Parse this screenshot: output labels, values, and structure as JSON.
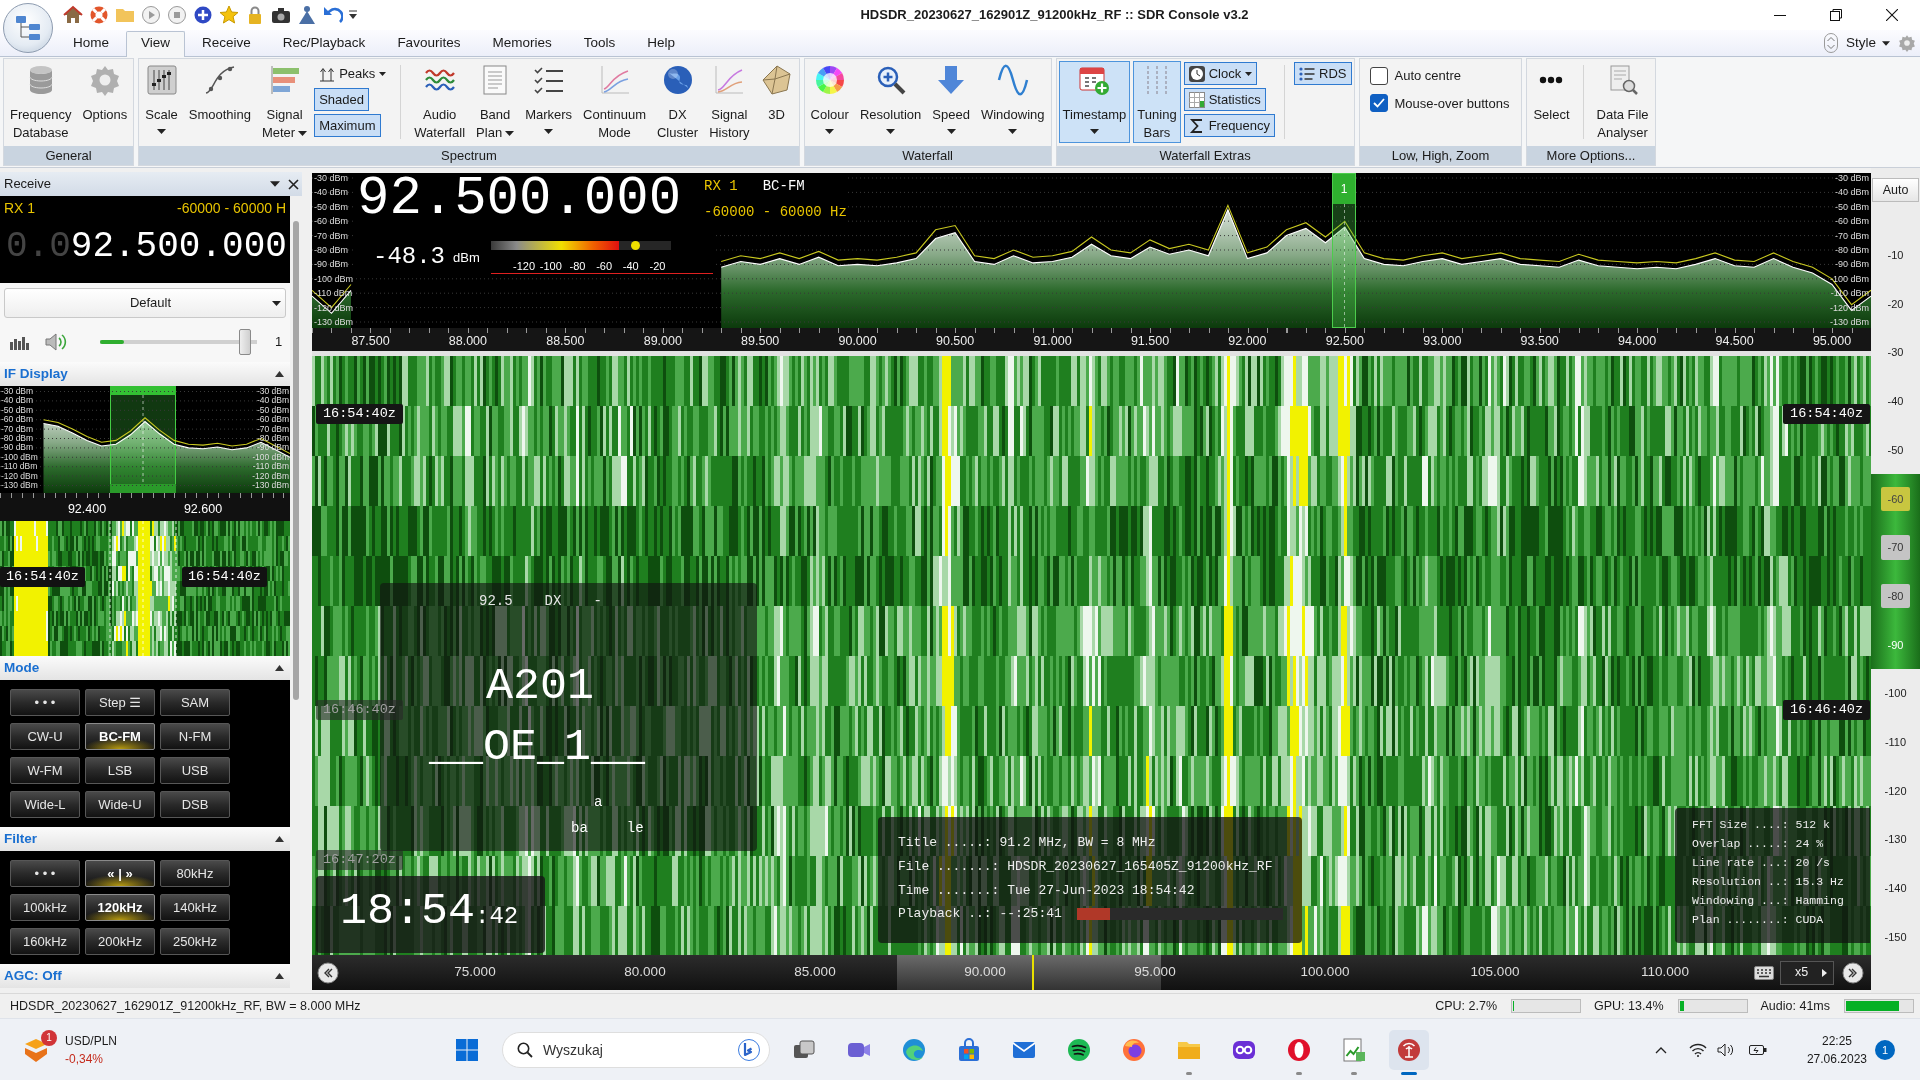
{
  "window": {
    "title": "HDSDR_20230627_162901Z_91200kHz_RF :: SDR Console v3.2"
  },
  "ribbon": {
    "tabs": [
      {
        "label": "Home",
        "selected": false
      },
      {
        "label": "View",
        "selected": true
      },
      {
        "label": "Receive",
        "selected": false
      },
      {
        "label": "Rec/Playback",
        "selected": false
      },
      {
        "label": "Favourites",
        "selected": false
      },
      {
        "label": "Memories",
        "selected": false
      },
      {
        "label": "Tools",
        "selected": false
      },
      {
        "label": "Help",
        "selected": false
      }
    ],
    "style_menu": "Style",
    "groups": [
      {
        "label": "General",
        "items": [
          {
            "kind": "large",
            "label": "Frequency\nDatabase",
            "dropdown": false,
            "on": false
          },
          {
            "kind": "large",
            "label": "Options",
            "dropdown": false,
            "on": false
          }
        ]
      },
      {
        "label": "Spectrum",
        "items": [
          {
            "kind": "large",
            "label": "Scale",
            "dropdown": true,
            "on": false
          },
          {
            "kind": "large",
            "label": "Smoothing",
            "dropdown": false,
            "on": false
          },
          {
            "kind": "large",
            "label": "Signal\nMeter",
            "dropdown": true,
            "on": false
          },
          {
            "kind": "small",
            "label": "Peaks",
            "dropdown": true,
            "on": false
          },
          {
            "kind": "small",
            "label": "Shaded",
            "dropdown": false,
            "on": true
          },
          {
            "kind": "small",
            "label": "Maximum",
            "dropdown": false,
            "on": true
          },
          {
            "kind": "separator"
          },
          {
            "kind": "large",
            "label": "Audio\nWaterfall",
            "dropdown": false,
            "on": false
          },
          {
            "kind": "large",
            "label": "Band\nPlan",
            "dropdown": true,
            "on": false
          },
          {
            "kind": "large",
            "label": "Markers",
            "dropdown": true,
            "on": false
          },
          {
            "kind": "large",
            "label": "Continuum\nMode",
            "dropdown": false,
            "on": false
          },
          {
            "kind": "large",
            "label": "DX\nCluster",
            "dropdown": false,
            "on": false
          },
          {
            "kind": "large",
            "label": "Signal\nHistory",
            "dropdown": false,
            "on": false
          },
          {
            "kind": "large",
            "label": "3D",
            "dropdown": false,
            "on": false
          }
        ]
      },
      {
        "label": "Waterfall",
        "items": [
          {
            "kind": "large",
            "label": "Colour",
            "dropdown": true,
            "on": false
          },
          {
            "kind": "large",
            "label": "Resolution",
            "dropdown": true,
            "on": false
          },
          {
            "kind": "large",
            "label": "Speed",
            "dropdown": true,
            "on": false
          },
          {
            "kind": "large",
            "label": "Windowing",
            "dropdown": true,
            "on": false
          }
        ]
      },
      {
        "label": "Waterfall Extras",
        "items": [
          {
            "kind": "large",
            "label": "Timestamp",
            "dropdown": true,
            "on": true
          },
          {
            "kind": "large",
            "label": "Tuning\nBars",
            "dropdown": false,
            "on": true
          },
          {
            "kind": "small",
            "label": "Clock",
            "dropdown": true,
            "on": true
          },
          {
            "kind": "small",
            "label": "Statistics",
            "dropdown": false,
            "on": true
          },
          {
            "kind": "small",
            "label": "Frequency",
            "dropdown": false,
            "on": true
          },
          {
            "kind": "separator"
          },
          {
            "kind": "small",
            "label": "RDS",
            "dropdown": false,
            "on": true
          }
        ]
      },
      {
        "label": "Low, High, Zoom",
        "items": [
          {
            "kind": "check",
            "label": "Auto centre",
            "checked": false
          },
          {
            "kind": "check",
            "label": "Mouse-over buttons",
            "checked": true
          }
        ]
      },
      {
        "label": "More Options...",
        "items": [
          {
            "kind": "large",
            "label": "Select",
            "dropdown": false,
            "on": false
          },
          {
            "kind": "separator"
          },
          {
            "kind": "large",
            "label": "Data File\nAnalyser",
            "dropdown": false,
            "on": false
          }
        ]
      }
    ]
  },
  "receive_panel": {
    "title": "Receive",
    "receiver": "RX 1",
    "span": "-60000 - 60000 H",
    "frequency_prefix": "0.0",
    "frequency": "92.500.000",
    "profile": "Default",
    "audio": {
      "level": 0.15
    },
    "volume": {
      "level": 0.96
    },
    "volume_value": "1",
    "if_display": {
      "title": "IF Display",
      "chart_data": {
        "type": "line",
        "x": [
          92.325,
          92.35,
          92.375,
          92.4,
          92.425,
          92.45,
          92.475,
          92.5,
          92.525,
          92.55,
          92.575,
          92.6,
          92.625,
          92.65,
          92.675,
          92.7,
          92.725,
          92.75
        ],
        "series": [
          {
            "color": "#ffffff",
            "values": [
              -64,
              -67,
              -74,
              -82,
              -88,
              -86,
              -76,
              -62,
              -75,
              -86,
              -90,
              -91,
              -89,
              -92,
              -90,
              -84,
              -92,
              -100
            ]
          },
          {
            "color": "#c8c820",
            "values": [
              -60,
              -63,
              -70,
              -78,
              -84,
              -82,
              -72,
              -58,
              -71,
              -82,
              -86,
              -87,
              -85,
              -88,
              -86,
              -80,
              -88,
              -96
            ]
          }
        ],
        "grid": true,
        "xlim": [
          92.25,
          92.75
        ],
        "ylim": [
          -138,
          -24.1
        ],
        "xticks": [
          {
            "value": 92.4,
            "label": "92.400"
          },
          {
            "value": 92.6,
            "label": "92.600"
          }
        ],
        "yticks": [
          {
            "value": -30,
            "label": "-30 dBm"
          },
          {
            "value": -40,
            "label": "-40 dBm"
          },
          {
            "value": -50,
            "label": "-50 dBm"
          },
          {
            "value": -60,
            "label": "-60 dBm"
          },
          {
            "value": -70,
            "label": "-70 dBm"
          },
          {
            "value": -80,
            "label": "-80 dBm"
          },
          {
            "value": -90,
            "label": "-90 dBm"
          },
          {
            "value": -100,
            "label": "-100 dBm"
          },
          {
            "value": -110,
            "label": "-110 dBm"
          },
          {
            "value": -120,
            "label": "-120 dBm"
          },
          {
            "value": -130,
            "label": "-130 dBm"
          }
        ]
      },
      "db_right": [
        "-30 dBm",
        "-40 dBm",
        "-50 dBm",
        "-60 dBm",
        "-70 dBm",
        "-80 dBm",
        "-90 dBm",
        "-100 dBm",
        "-110 dBm",
        "-120 dBm",
        "-130 dBm"
      ],
      "timestamps": [
        "16:54:40z",
        "16:54:40z"
      ]
    },
    "mode": {
      "title": "Mode",
      "buttons": [
        {
          "label": "• • •",
          "selected": false
        },
        {
          "label": "Step ☰",
          "selected": false
        },
        {
          "label": "SAM",
          "selected": false
        },
        {
          "label": "CW-U",
          "selected": false
        },
        {
          "label": "BC-FM",
          "selected": true
        },
        {
          "label": "N-FM",
          "selected": false
        },
        {
          "label": "W-FM",
          "selected": false
        },
        {
          "label": "LSB",
          "selected": false
        },
        {
          "label": "USB",
          "selected": false
        },
        {
          "label": "Wide-L",
          "selected": false
        },
        {
          "label": "Wide-U",
          "selected": false
        },
        {
          "label": "DSB",
          "selected": false
        }
      ]
    },
    "filter": {
      "title": "Filter",
      "buttons": [
        {
          "label": "• • •",
          "selected": false
        },
        {
          "label": "« | »",
          "selected": true
        },
        {
          "label": "80kHz",
          "selected": false
        },
        {
          "label": "100kHz",
          "selected": false
        },
        {
          "label": "120kHz",
          "selected": true
        },
        {
          "label": "140kHz",
          "selected": false
        },
        {
          "label": "160kHz",
          "selected": false
        },
        {
          "label": "200kHz",
          "selected": false
        },
        {
          "label": "250kHz",
          "selected": false
        }
      ]
    },
    "agc": {
      "title": "AGC: Off"
    }
  },
  "spectrum": {
    "frequency": "92.500.000",
    "receiver": "RX 1",
    "mode": "BC-FM",
    "span": "-60000 - 60000 Hz",
    "signal": "-48.3",
    "signal_unit": "dBm",
    "meter": {
      "level": 0.71,
      "scale": [
        "-120",
        "-100",
        "-80",
        "-60",
        "-40",
        "-20"
      ]
    },
    "chart_data": {
      "type": "line",
      "x": [
        87.2,
        87.3,
        87.4,
        89.3,
        89.4,
        89.5,
        89.6,
        89.7,
        89.8,
        89.9,
        90,
        90.1,
        90.2,
        90.3,
        90.4,
        90.5,
        90.6,
        90.7,
        90.8,
        90.9,
        91,
        91.1,
        91.2,
        91.3,
        91.4,
        91.5,
        91.6,
        91.7,
        91.8,
        91.9,
        92,
        92.1,
        92.2,
        92.3,
        92.4,
        92.5,
        92.6,
        92.7,
        92.8,
        92.9,
        93,
        93.1,
        93.2,
        93.3,
        93.4,
        93.5,
        93.6,
        93.7,
        93.8,
        93.9,
        94,
        94.1,
        94.2,
        94.3,
        94.4,
        94.5,
        94.6,
        94.7,
        94.8,
        94.9,
        95,
        95.1,
        95.2
      ],
      "series": [
        {
          "color": "#ffffff",
          "values": [
            -112,
            -124,
            -108,
            -92,
            -88,
            -90,
            -86,
            -90,
            -85,
            -91,
            -90,
            -91,
            -89,
            -86,
            -72,
            -68,
            -88,
            -90,
            -84,
            -89,
            -88,
            -85,
            -76,
            -84,
            -86,
            -78,
            -83,
            -80,
            -84,
            -52,
            -86,
            -82,
            -70,
            -65,
            -75,
            -64,
            -86,
            -90,
            -91,
            -88,
            -86,
            -90,
            -88,
            -86,
            -90,
            -91,
            -92,
            -87,
            -91,
            -92,
            -93,
            -92,
            -93,
            -90,
            -86,
            -91,
            -92,
            -86,
            -92,
            -96,
            -104,
            -122,
            -112
          ]
        },
        {
          "color": "#c8c820",
          "values": [
            -108,
            -120,
            -104,
            -88,
            -84,
            -86,
            -82,
            -86,
            -81,
            -87,
            -86,
            -87,
            -85,
            -82,
            -66,
            -63,
            -84,
            -86,
            -80,
            -85,
            -84,
            -81,
            -71,
            -80,
            -82,
            -73,
            -79,
            -76,
            -80,
            -49,
            -82,
            -78,
            -66,
            -61,
            -71,
            -60,
            -82,
            -86,
            -87,
            -84,
            -82,
            -86,
            -84,
            -82,
            -86,
            -87,
            -88,
            -83,
            -87,
            -88,
            -89,
            -88,
            -89,
            -86,
            -82,
            -87,
            -88,
            -82,
            -88,
            -92,
            -100,
            -118,
            -108
          ]
        }
      ],
      "grid": true,
      "xlim": [
        87.2,
        95.2
      ],
      "ylim": [
        -134.2,
        -26.5
      ],
      "xticks": [
        {
          "value": 87.5,
          "label": "87.500"
        },
        {
          "value": 88,
          "label": "88.000"
        },
        {
          "value": 88.5,
          "label": "88.500"
        },
        {
          "value": 89,
          "label": "89.000"
        },
        {
          "value": 89.5,
          "label": "89.500"
        },
        {
          "value": 90,
          "label": "90.000"
        },
        {
          "value": 90.5,
          "label": "90.500"
        },
        {
          "value": 91,
          "label": "91.000"
        },
        {
          "value": 91.5,
          "label": "91.500"
        },
        {
          "value": 92,
          "label": "92.000"
        },
        {
          "value": 92.5,
          "label": "92.500"
        },
        {
          "value": 93,
          "label": "93.000"
        },
        {
          "value": 93.5,
          "label": "93.500"
        },
        {
          "value": 94,
          "label": "94.000"
        },
        {
          "value": 94.5,
          "label": "94.500"
        },
        {
          "value": 95,
          "label": "95.000"
        }
      ],
      "yticks": [
        {
          "value": -30,
          "label": "-30 dBm"
        },
        {
          "value": -40,
          "label": "-40 dBm"
        },
        {
          "value": -50,
          "label": "-50 dBm"
        },
        {
          "value": -60,
          "label": "-60 dBm"
        },
        {
          "value": -70,
          "label": "-70 dBm"
        },
        {
          "value": -80,
          "label": "-80 dBm"
        },
        {
          "value": -90,
          "label": "-90 dBm"
        },
        {
          "value": -100,
          "label": "-100 dBm"
        },
        {
          "value": -110,
          "label": "-110 dBm"
        },
        {
          "value": -120,
          "label": "-120 dBm"
        },
        {
          "value": -130,
          "label": "-130 dBm"
        }
      ]
    },
    "db_right": [
      "-30 dBm",
      "-40 dBm",
      "-50 dBm",
      "-60 dBm",
      "-70 dBm",
      "-80 dBm",
      "-90 dBm",
      "-100 dBm",
      "-110 dBm",
      "-120 dBm",
      "-130 dBm"
    ],
    "marker": "1"
  },
  "waterfall": {
    "timestamp_rows": [
      {
        "left": {
          "text": "16:54:40z",
          "dimmed": false
        },
        "right": {
          "text": "16:54:40z",
          "dimmed": false
        }
      },
      {
        "left": {
          "text": "16:46:40z",
          "dimmed": true
        },
        "right": {
          "text": "16:46:40z",
          "dimmed": false
        }
      },
      {
        "left": {
          "text": "16:47:20z",
          "dimmed": true
        }
      }
    ],
    "rds": {
      "frequency": "92.5",
      "type": "DX",
      "pty": "-",
      "lines": [
        "A201",
        "__OE_1__"
      ],
      "radiotext": [
        [
          "a"
        ],
        [
          "ba",
          "le"
        ]
      ]
    },
    "clock": {
      "time": "18:54",
      "seconds": ":42"
    },
    "file_info": [
      "Title .....: 91.2 MHz, BW = 8 MHz",
      "File .......: HDSDR_20230627_165405Z_91200kHz_RF",
      "Time .......: Tue 27-Jun-2023 18:54:42"
    ],
    "playback": {
      "text": "Playback ..: --:25:41",
      "level": 0.16
    },
    "stats": [
      "FFT Size ....: 512 k",
      "Overlap .....: 24 %",
      "Line rate ...: 20 /s",
      "Resolution ..: 15.3 Hz",
      "Windowing ...: Hamming",
      "Plan ........: CUDA"
    ],
    "overview_axis": [
      "75.000",
      "80.000",
      "85.000",
      "90.000",
      "95.000",
      "100.000",
      "105.000",
      "110.000"
    ],
    "zoom": "x5"
  },
  "level_scale": {
    "auto": "Auto",
    "labels": [
      {
        "text": "-10",
        "kind": "plain"
      },
      {
        "text": "-20",
        "kind": "plain"
      },
      {
        "text": "-30",
        "kind": "plain"
      },
      {
        "text": "-40",
        "kind": "plain"
      },
      {
        "text": "-50",
        "kind": "plain"
      },
      {
        "text": "-60",
        "kind": "high"
      },
      {
        "text": "-70",
        "kind": "handle"
      },
      {
        "text": "-80",
        "kind": "handle"
      },
      {
        "text": "-90",
        "kind": "band"
      },
      {
        "text": "-100",
        "kind": "plain"
      },
      {
        "text": "-110",
        "kind": "plain"
      },
      {
        "text": "-120",
        "kind": "plain"
      },
      {
        "text": "-130",
        "kind": "plain"
      },
      {
        "text": "-140",
        "kind": "plain"
      },
      {
        "text": "-150",
        "kind": "plain"
      }
    ]
  },
  "status_bar": {
    "text": "HDSDR_20230627_162901Z_91200kHz_RF, BW = 8.000 MHz",
    "meters": [
      {
        "label": "CPU: 2.7%",
        "level": 0.02
      },
      {
        "label": "GPU: 13.4%",
        "level": 0.06
      },
      {
        "label": "Audio: 41ms",
        "level": 0.8
      }
    ]
  },
  "taskbar": {
    "widget": {
      "ticker": "USD/PLN",
      "change": "-0,34%",
      "badge": "1"
    },
    "search": {
      "placeholder": "Wyszukaj"
    },
    "apps": [
      {
        "kind": "taskview",
        "running": false,
        "active": false
      },
      {
        "kind": "chat",
        "running": false,
        "active": false
      },
      {
        "kind": "edge",
        "running": false,
        "active": false
      },
      {
        "kind": "store",
        "running": false,
        "active": false
      },
      {
        "kind": "mail",
        "running": false,
        "active": false
      },
      {
        "kind": "spotify",
        "running": false,
        "active": false
      },
      {
        "kind": "firefox",
        "running": false,
        "active": false
      },
      {
        "kind": "explorer",
        "running": true,
        "active": false
      },
      {
        "kind": "purple",
        "running": false,
        "active": false
      },
      {
        "kind": "opera",
        "running": true,
        "active": false
      },
      {
        "kind": "chart",
        "running": true,
        "active": false
      },
      {
        "kind": "radio",
        "running": true,
        "active": true
      }
    ],
    "clock": {
      "time": "22:25",
      "date": "27.06.2023"
    },
    "notifications": "1"
  }
}
